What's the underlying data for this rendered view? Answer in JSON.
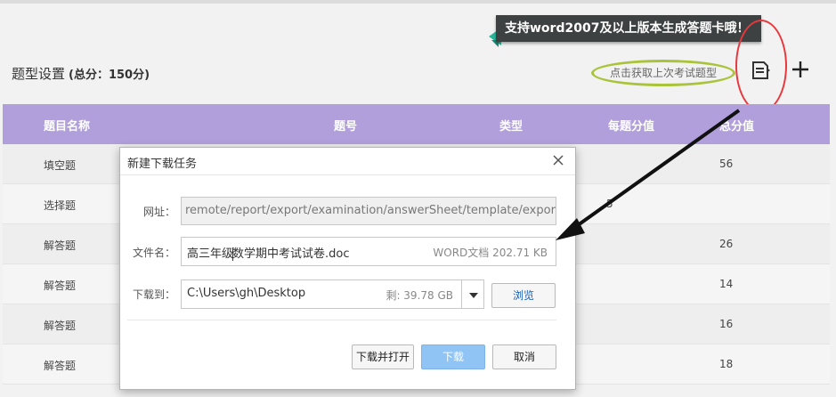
{
  "header": {
    "title": "题型设置",
    "total": "(总分：150分)",
    "prev_exam_link": "点击获取上次考试题型",
    "tooltip": "支持word2007及以上版本生成答题卡哦！",
    "icons": [
      "document-edit-icon",
      "plus-icon"
    ]
  },
  "table": {
    "columns": [
      "题目名称",
      "题号",
      "类型",
      "每题分值",
      "总分值"
    ],
    "rows": [
      {
        "name": "填空题",
        "per": "",
        "total": "56"
      },
      {
        "name": "选择题",
        "per": "5",
        "total": ""
      },
      {
        "name": "解答题",
        "per": "",
        "total": "26"
      },
      {
        "name": "解答题",
        "per": "",
        "total": "14"
      },
      {
        "name": "解答题",
        "per": "",
        "total": "16"
      },
      {
        "name": "解答题",
        "per": "",
        "total": "18"
      }
    ]
  },
  "dialog": {
    "title": "新建下载任务",
    "url_label": "网址：",
    "url_value": "remote/report/export/examination/answerSheet/template/export/word",
    "filename_label": "文件名：",
    "filename_before_caret": "高三年级",
    "filename_after_caret": "数学期中考试试卷.doc",
    "filesize": "WORD文档 202.71 KB",
    "saveto_label": "下载到：",
    "saveto_path": "C:\\Users\\gh\\Desktop",
    "free_space": "剩: 39.78 GB",
    "browse": "浏览",
    "open_after": "下载并打开",
    "download": "下载",
    "cancel": "取消"
  },
  "colors": {
    "table_header": "#b19fdb",
    "download_button": "#8fc4f4",
    "tooltip_bg": "#3d4141",
    "highlight_oval": "#a9c43b",
    "annotation_red": "#e8383d"
  }
}
